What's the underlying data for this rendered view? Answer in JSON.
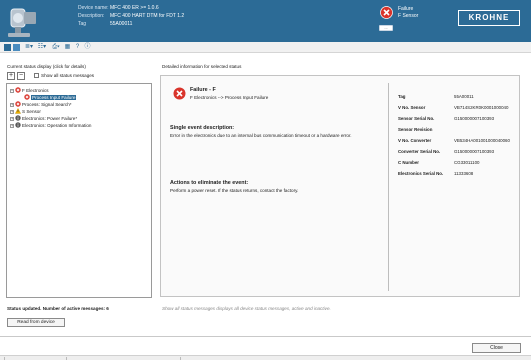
{
  "header": {
    "device_name_label": "Device name:",
    "device_name": "MFC 400 ER >= 1.0.6",
    "description_label": "Description:",
    "description": "MFC 400 HART DTM for FDT 1.2",
    "tag_label": "Tag",
    "tag": "55A00011",
    "status_title": "Failure",
    "status_sub": "F Sensor",
    "status_dropdown": "...",
    "brand": "KROHNE"
  },
  "toolbar": {
    "icons": [
      "window-icon",
      "window-split-icon",
      "list-icon",
      "list-alt-icon",
      "print-icon",
      "chart-icon",
      "help-icon",
      "info-icon"
    ]
  },
  "left": {
    "title": "Current status display (click for details)",
    "expand": "+",
    "collapse": "−",
    "show_all_label": "Show all status messages",
    "tree": [
      {
        "label": "F Electronics",
        "icon": "error",
        "expand": "−",
        "level": 0
      },
      {
        "label": "Process Input Failure",
        "icon": "error",
        "expand": "",
        "level": 1,
        "selected": true
      },
      {
        "label": "Process: Signal Search*",
        "icon": "error",
        "expand": "+",
        "level": 0
      },
      {
        "label": "S Sensor",
        "icon": "warning",
        "expand": "+",
        "level": 0
      },
      {
        "label": "Electronics: Power Failure*",
        "icon": "info",
        "expand": "+",
        "level": 0
      },
      {
        "label": "Electronics: Operation Information",
        "icon": "info",
        "expand": "+",
        "level": 0
      }
    ],
    "status_text": "Status updated. Number of active messages: 6",
    "read_button": "Read from device"
  },
  "right": {
    "title": "Detailed information for selected status",
    "failure_title": "Failure - F",
    "failure_sub": "F Electronics --> Process Input Failure",
    "single_head": "Single event description:",
    "single_body": "Error in the electronics due to an internal bus communication timeout or a hardware error.",
    "actions_head": "Actions to eliminate the event:",
    "actions_body": "Perform a power reset. If the status returns, contact the factory.",
    "info": [
      {
        "k": "Tag",
        "v": "55A00011"
      },
      {
        "k": "V No. Sensor",
        "v": "VB714S2KR0K0001000040"
      },
      {
        "k": "Sensor Serial No.",
        "v": "G150000007100393"
      },
      {
        "k": "Sensor Revision",
        "v": ""
      },
      {
        "k": "V No. Converter",
        "v": "VB534HA001001000040060"
      },
      {
        "k": "Converter Serial No.",
        "v": "G150000007100393"
      },
      {
        "k": "C Number",
        "v": "CG33011100"
      },
      {
        "k": "Electronics Serial No.",
        "v": "11333608"
      }
    ]
  },
  "footnote": "Show all status messages displays all device status messages, active and inactive.",
  "close_button": "Close",
  "colors": {
    "header_bg": "#2c6b96",
    "error": "#d9342b",
    "warning": "#f2b400",
    "info": "#5a5a5a",
    "selection": "#2c6b96"
  }
}
